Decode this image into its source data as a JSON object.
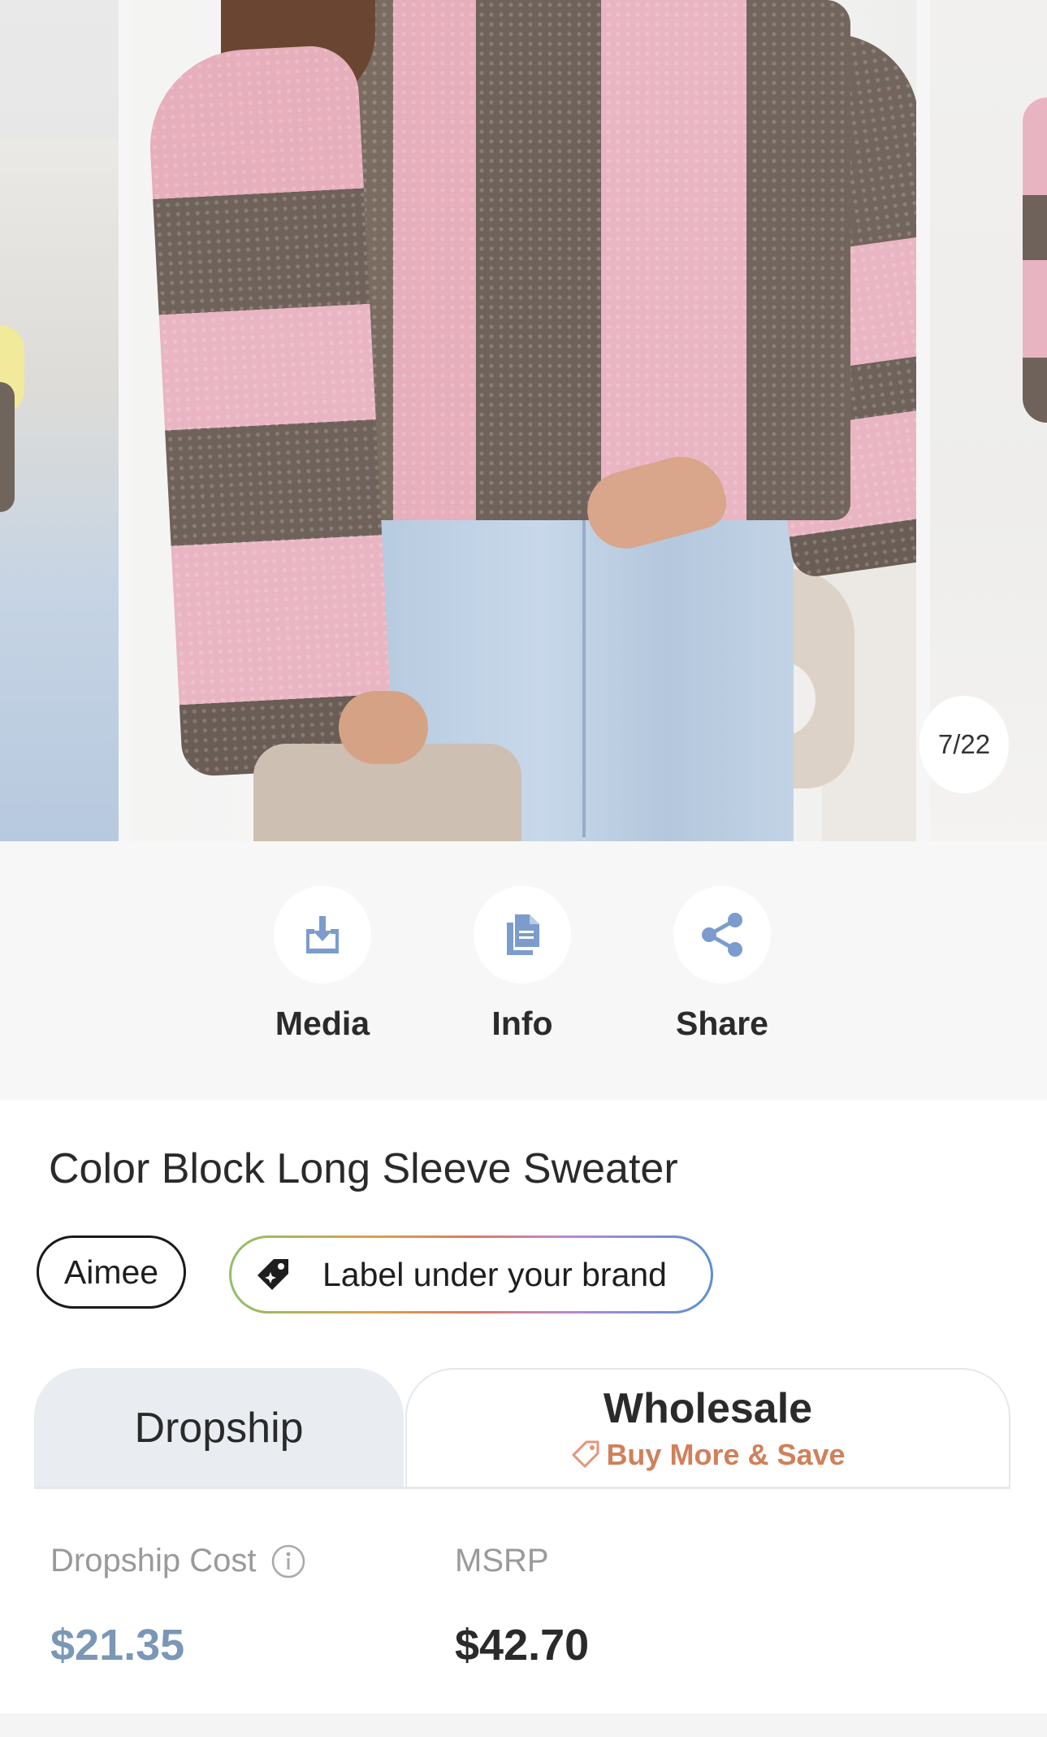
{
  "gallery": {
    "counter": "7/22"
  },
  "actions": [
    {
      "label": "Media",
      "icon": "download-icon"
    },
    {
      "label": "Info",
      "icon": "documents-icon"
    },
    {
      "label": "Share",
      "icon": "share-icon"
    }
  ],
  "product": {
    "title": "Color Block Long Sleeve Sweater",
    "brand": "Aimee",
    "label_chip": "Label under your brand"
  },
  "tabs": {
    "dropship": "Dropship",
    "wholesale": "Wholesale",
    "wholesale_sub": "Buy More & Save"
  },
  "pricing": {
    "cost_label": "Dropship Cost",
    "cost_value": "$21.35",
    "msrp_label": "MSRP",
    "msrp_value": "$42.70"
  },
  "colors": {
    "accent_blue": "#7a97b6",
    "icon_blue": "#7b9ccd",
    "promo_orange": "#d0805a",
    "text_dark": "#2a2a2a"
  }
}
